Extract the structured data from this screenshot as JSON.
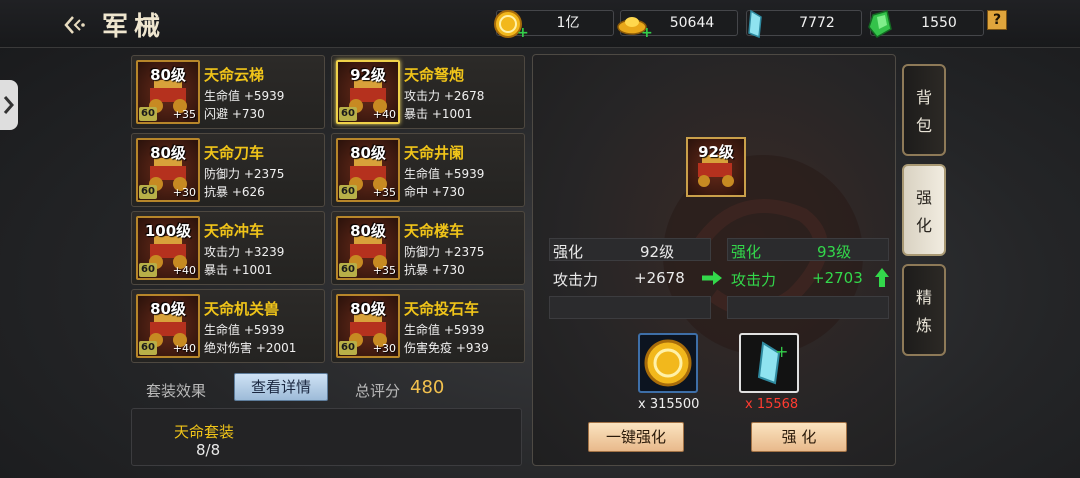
{
  "header": {
    "title": "军械"
  },
  "currencies": [
    {
      "name": "gold-coin",
      "value": "1亿",
      "has_plus": true
    },
    {
      "name": "gold-ingot",
      "value": "50644",
      "has_plus": true
    },
    {
      "name": "blue-crystal",
      "value": "7772",
      "has_plus": false
    },
    {
      "name": "green-gem",
      "value": "1550",
      "has_plus": false
    }
  ],
  "help_label": "?",
  "equipment": [
    {
      "level": "80级",
      "tier": "60",
      "plus": "+35",
      "name": "天命云梯",
      "stat1": "生命值 +5939",
      "stat2": "闪避 +730",
      "selected": false
    },
    {
      "level": "92级",
      "tier": "60",
      "plus": "+40",
      "name": "天命弩炮",
      "stat1": "攻击力 +2678",
      "stat2": "暴击 +1001",
      "selected": true
    },
    {
      "level": "80级",
      "tier": "60",
      "plus": "+30",
      "name": "天命刀车",
      "stat1": "防御力 +2375",
      "stat2": "抗暴 +626",
      "selected": false
    },
    {
      "level": "80级",
      "tier": "60",
      "plus": "+35",
      "name": "天命井阑",
      "stat1": "生命值 +5939",
      "stat2": "命中 +730",
      "selected": false
    },
    {
      "level": "100级",
      "tier": "60",
      "plus": "+40",
      "name": "天命冲车",
      "stat1": "攻击力 +3239",
      "stat2": "暴击 +1001",
      "selected": false
    },
    {
      "level": "80级",
      "tier": "60",
      "plus": "+35",
      "name": "天命楼车",
      "stat1": "防御力 +2375",
      "stat2": "抗暴 +730",
      "selected": false
    },
    {
      "level": "80级",
      "tier": "60",
      "plus": "+40",
      "name": "天命机关兽",
      "stat1": "生命值 +5939",
      "stat2": "绝对伤害 +2001",
      "selected": false
    },
    {
      "level": "80级",
      "tier": "60",
      "plus": "+30",
      "name": "天命投石车",
      "stat1": "生命值 +5939",
      "stat2": "伤害免疫 +939",
      "selected": false
    }
  ],
  "set_bar": {
    "label": "套装效果",
    "detail_button": "查看详情",
    "score_label": "总评分",
    "score_value": "480"
  },
  "set_panel": {
    "name": "天命套装",
    "count": "8/8"
  },
  "enhance": {
    "item_level": "92级",
    "current": {
      "k1": "强化",
      "v1": "92级",
      "k2": "攻击力",
      "v2": "+2678"
    },
    "next": {
      "k1": "强化",
      "v1": "93级",
      "k2": "攻击力",
      "v2": "+2703"
    },
    "cost1": {
      "icon": "gold-coin",
      "text": "x 315500",
      "color": "#f0f0f0"
    },
    "cost2": {
      "icon": "blue-crystal",
      "text": "x 15568",
      "color": "#ff3b30"
    },
    "one_click_button": "一键强化",
    "enhance_button": "强 化"
  },
  "tabs": [
    {
      "label": "背\n包",
      "active": false
    },
    {
      "label": "强\n化",
      "active": true
    },
    {
      "label": "精\n炼",
      "active": false
    }
  ]
}
